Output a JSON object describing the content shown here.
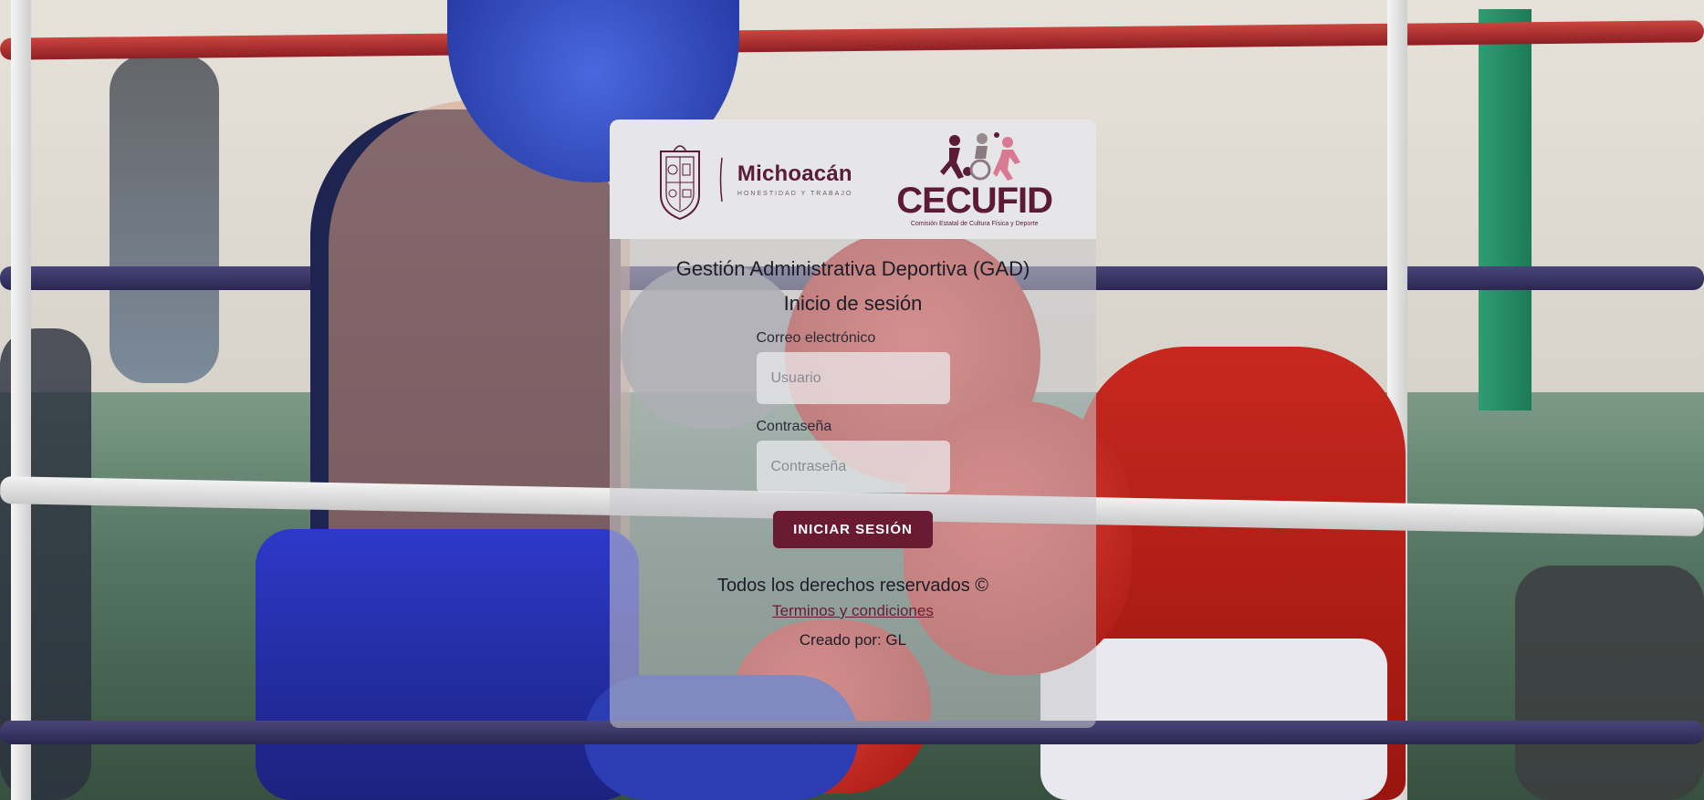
{
  "colors": {
    "brand_primary": "#6b1a33",
    "brand_text": "#5b1b33",
    "header_bg": "#e6e6e9"
  },
  "header": {
    "michoacan": {
      "crest_icon": "state-coat-of-arms-icon",
      "name": "Michoacán",
      "motto": "HONESTIDAD Y TRABAJO"
    },
    "cecufid": {
      "figures_icon": "athletes-figures-icon",
      "name": "CECUFID",
      "subtitle": "Comisión Estatal de Cultura Física y Deporte"
    }
  },
  "main": {
    "title": "Gestión Administrativa Deportiva (GAD)",
    "subtitle": "Inicio de sesión"
  },
  "form": {
    "email": {
      "label": "Correo electrónico",
      "value": "",
      "placeholder": "Usuario"
    },
    "password": {
      "label": "Contraseña",
      "value": "",
      "placeholder": "Contraseña"
    },
    "submit_label": "INICIAR SESIÓN"
  },
  "footer": {
    "rights": "Todos los derechos reservados ©",
    "terms_link": "Terminos y condiciones",
    "created_by": "Creado por: GL"
  }
}
